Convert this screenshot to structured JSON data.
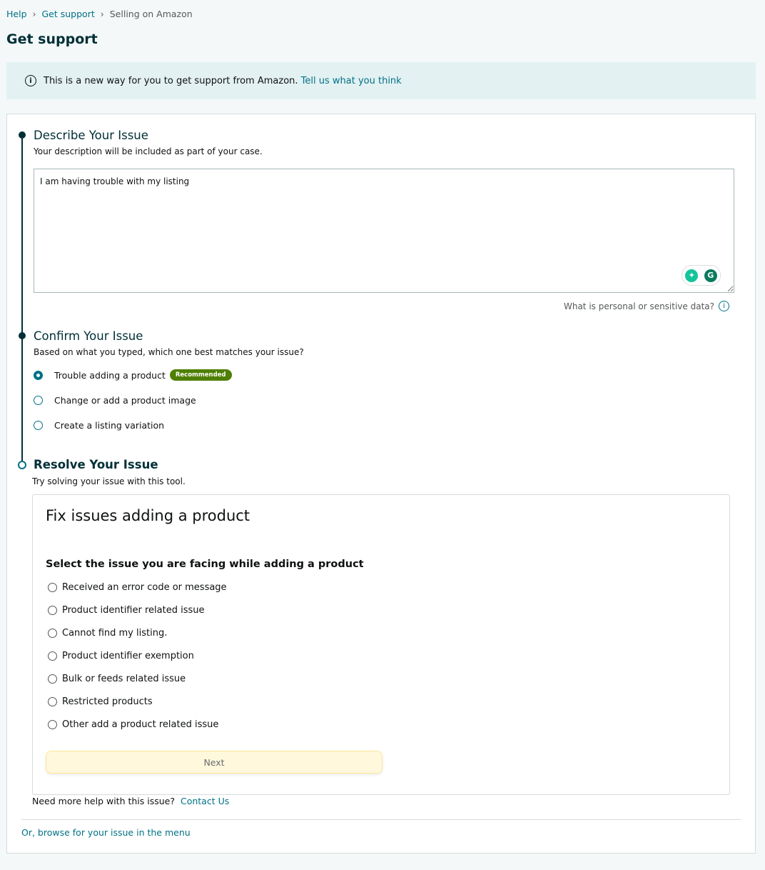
{
  "breadcrumb": [
    "Help",
    "Get support",
    "Selling on Amazon"
  ],
  "page_title": "Get support",
  "banner": {
    "text": "This is a new way for you to get support from Amazon.",
    "link": "Tell us what you think"
  },
  "describe": {
    "title": "Describe Your Issue",
    "subtitle": "Your description will be included as part of your case.",
    "value": "I am having trouble with my listing",
    "sensitive_link": "What is personal or sensitive data?"
  },
  "confirm": {
    "title": "Confirm Your Issue",
    "subtitle": "Based on what you typed, which one best matches your issue?",
    "options": [
      "Trouble adding a product",
      "Change or add a product image",
      "Create a listing variation"
    ],
    "badge": "Recommended",
    "selected": 0
  },
  "resolve": {
    "title": "Resolve Your Issue",
    "subtitle": "Try solving your issue with this tool.",
    "tool_title": "Fix issues adding a product",
    "question": "Select the issue you are facing while adding a product",
    "options": [
      "Received an error code or message",
      "Product identifier related issue",
      "Cannot find my listing.",
      "Product identifier exemption",
      "Bulk or feeds related issue",
      "Restricted products",
      "Other add a product related issue"
    ],
    "next": "Next"
  },
  "help": {
    "text": "Need more help with this issue?",
    "link": "Contact Us"
  },
  "browse_link": "Or, browse for your issue in the menu",
  "colors": {
    "accent": "#007185",
    "heading": "#002f36",
    "badge": "#4f7f02",
    "banner": "#e3f1f3"
  }
}
